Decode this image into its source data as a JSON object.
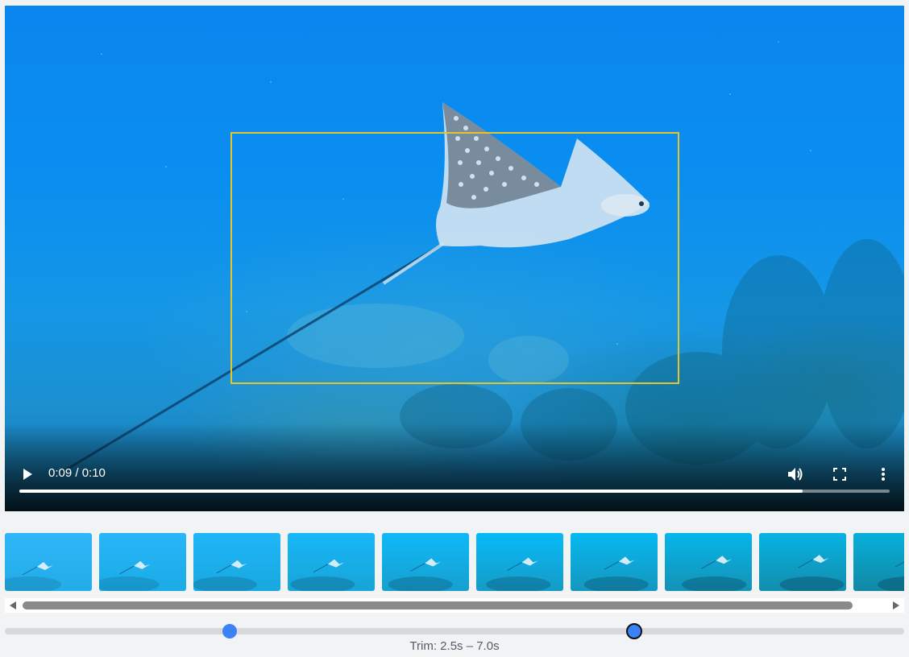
{
  "player": {
    "time_display": "0:09 / 0:10",
    "progress_fraction": 0.9,
    "bbox_color": "#e6c52b",
    "controls": {
      "play_icon": "play-icon",
      "volume_icon": "volume-icon",
      "fullscreen_icon": "fullscreen-icon",
      "more_icon": "more-vert-icon"
    }
  },
  "filmstrip": {
    "thumbnail_count": 10
  },
  "trim": {
    "label": "Trim: 2.5s – 7.0s",
    "start_fraction": 0.25,
    "end_fraction": 0.7,
    "accent_color": "#3b82f6"
  }
}
